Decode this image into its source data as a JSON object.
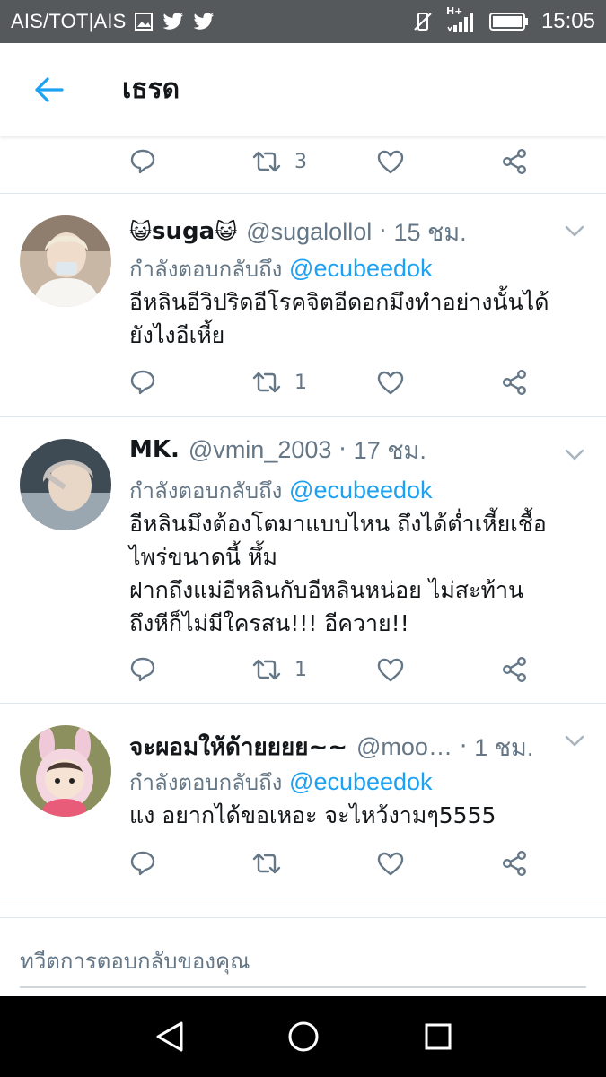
{
  "status_bar": {
    "carrier": "AIS/TOT|AIS",
    "time": "15:05",
    "network": "H+"
  },
  "header": {
    "title": "เธรด"
  },
  "top_actions": {
    "retweet_count": "3"
  },
  "tweets": [
    {
      "name": "suga",
      "name_emoji": "😺",
      "handle": "@sugalollol",
      "dot": "·",
      "time": "15 ชม.",
      "replying_prefix": "กำลังตอบกลับถึง",
      "replying_to": "@ecubeedok",
      "lines": [
        "อีหลินอีวิปริดอีโรคจิตอีดอกมึงทำอย่างนั้นได้",
        "ยังไงอีเหี้ย"
      ],
      "retweet_count": "1"
    },
    {
      "name": "MK.",
      "handle": "@vmin_2003",
      "dot": "·",
      "time": "17 ชม.",
      "replying_prefix": "กำลังตอบกลับถึง",
      "replying_to": "@ecubeedok",
      "lines": [
        "อีหลินมึงต้องโตมาแบบไหน ถึงได้ต่ำเหี้ยเชื้อ",
        "ไพร่ขนาดนี้ หึ้ม",
        "ฝากถึงแม่อีหลินกับอีหลินหน่อย ไม่สะท้าน",
        "ถึงหีก็ไม่มีใครสน!!! อีควาย!!"
      ],
      "retweet_count": "1"
    },
    {
      "name": "จะผอมให้ด้ายยยย~~",
      "handle": "@moo…",
      "dot": "·",
      "time": "1 ชม.",
      "replying_prefix": "กำลังตอบกลับถึง",
      "replying_to": "@ecubeedok",
      "lines": [
        "แง อยากได้ขอเหอะ จะไหว้งามๆ5555"
      ],
      "retweet_count": ""
    }
  ],
  "reply_box": {
    "placeholder": "ทวีตการตอบกลับของคุณ"
  },
  "colors": {
    "accent": "#1da1f2",
    "secondary_text": "#657786",
    "status_bar": "#55595c"
  }
}
